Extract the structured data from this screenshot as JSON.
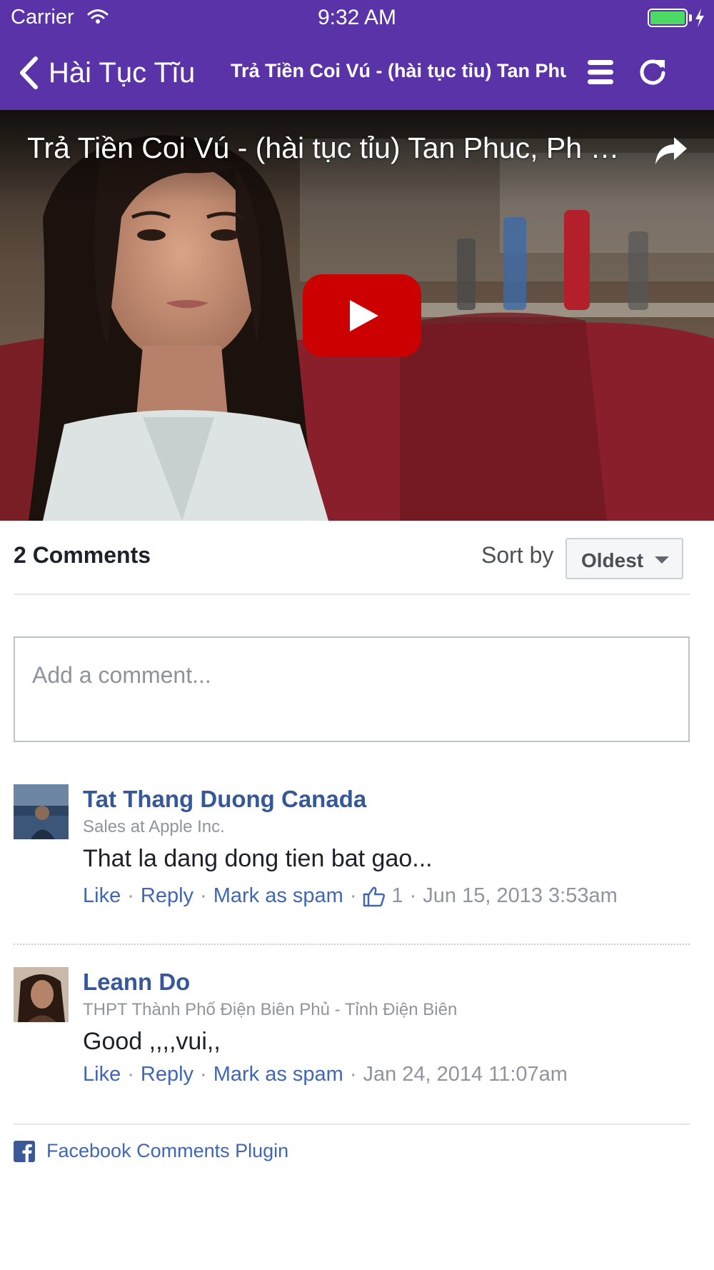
{
  "status_bar": {
    "carrier": "Carrier",
    "time": "9:32 AM",
    "battery_level": 1.0
  },
  "nav": {
    "back_label": "Hài Tục Tĩu",
    "title": "Trả Tiền Coi Vú - (hài tục tỉu) Tan Phuc, Phuong Vy",
    "icons": [
      "back-chevron-icon",
      "menu-icon",
      "refresh-icon"
    ]
  },
  "video": {
    "title": "Trả Tiền Coi Vú - (hài tục tỉu) Tan Phuc, Ph …",
    "icons": [
      "share-icon",
      "play-icon"
    ],
    "play_color": "#cc0000"
  },
  "comments_header": {
    "count_label": "2 Comments",
    "sort_label": "Sort by",
    "sort_value": "Oldest"
  },
  "comment_box": {
    "placeholder": "Add a comment..."
  },
  "comments": [
    {
      "name": "Tat Thang Duong Canada",
      "subtitle": "Sales at Apple Inc.",
      "text": "That la dang dong tien bat gao...",
      "actions": {
        "like": "Like",
        "reply": "Reply",
        "spam": "Mark as spam"
      },
      "likes": "1",
      "timestamp": "Jun 15, 2013 3:53am"
    },
    {
      "name": "Leann Do",
      "subtitle": "THPT Thành Phố Điện Biên Phủ - Tỉnh Điện Biên",
      "text": "Good ,,,,vui,,",
      "actions": {
        "like": "Like",
        "reply": "Reply",
        "spam": "Mark as spam"
      },
      "timestamp": "Jan 24, 2014 11:07am"
    }
  ],
  "footer": {
    "plugin_label": "Facebook Comments Plugin",
    "icon": "facebook-icon"
  },
  "colors": {
    "header": "#5b33a9",
    "link": "#4267b2",
    "name": "#365899",
    "meta": "#90949c"
  }
}
